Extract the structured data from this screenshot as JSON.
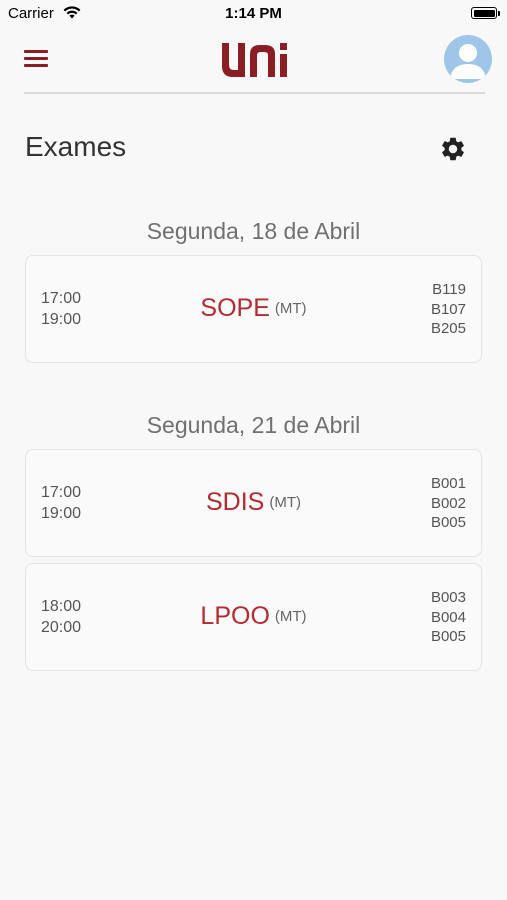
{
  "status_bar": {
    "carrier": "Carrier",
    "time": "1:14 PM"
  },
  "navbar": {
    "logo_icon": "uni-logo",
    "menu_icon": "hamburger-icon",
    "avatar_icon": "user-avatar-icon"
  },
  "page": {
    "title": "Exames",
    "settings_icon": "gear-icon"
  },
  "colors": {
    "brand": "#8b1d24",
    "subject": "#b52a2f"
  },
  "days": [
    {
      "heading": "Segunda, 18 de Abril",
      "exams": [
        {
          "start": "17:00",
          "end": "19:00",
          "subject": "SOPE",
          "type": "(MT)",
          "rooms": [
            "B119",
            "B107",
            "B205"
          ]
        }
      ]
    },
    {
      "heading": "Segunda, 21 de Abril",
      "exams": [
        {
          "start": "17:00",
          "end": "19:00",
          "subject": "SDIS",
          "type": "(MT)",
          "rooms": [
            "B001",
            "B002",
            "B005"
          ]
        },
        {
          "start": "18:00",
          "end": "20:00",
          "subject": "LPOO",
          "type": "(MT)",
          "rooms": [
            "B003",
            "B004",
            "B005"
          ]
        }
      ]
    }
  ]
}
